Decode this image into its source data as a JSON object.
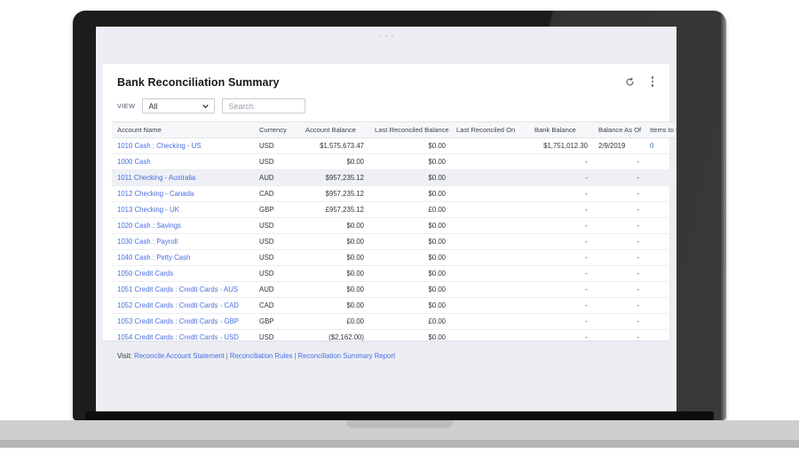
{
  "app": {
    "title": "Bank Reconciliation Summary"
  },
  "header": {
    "refresh_icon": "refresh-icon",
    "menu_icon": "kebab-menu-icon"
  },
  "toolbar": {
    "view_label": "VIEW",
    "view_value": "All",
    "view_options": [
      "All"
    ],
    "search_placeholder": "Search",
    "search_value": ""
  },
  "table": {
    "columns": [
      "Account Name",
      "Currency",
      "Account Balance",
      "Last Reconciled Balance",
      "Last Reconciled On",
      "Bank Balance",
      "Balance As Of",
      "Items to Match"
    ],
    "rows": [
      {
        "account": "1010 Cash : Checking - US",
        "currency": "USD",
        "account_balance": "$1,575,673.47",
        "last_reconciled_balance": "$0.00",
        "last_reconciled_on": "",
        "bank_balance": "$1,751,012.30",
        "balance_as_of": "2/9/2019",
        "items_to_match": "0",
        "highlight": false
      },
      {
        "account": "1000 Cash",
        "currency": "USD",
        "account_balance": "$0.00",
        "last_reconciled_balance": "$0.00",
        "last_reconciled_on": "",
        "bank_balance": "-",
        "balance_as_of": "-",
        "items_to_match": "-",
        "highlight": false
      },
      {
        "account": "1011 Checking - Australia",
        "currency": "AUD",
        "account_balance": "$957,235.12",
        "last_reconciled_balance": "$0.00",
        "last_reconciled_on": "",
        "bank_balance": "-",
        "balance_as_of": "-",
        "items_to_match": "-",
        "highlight": true
      },
      {
        "account": "1012 Checking - Canada",
        "currency": "CAD",
        "account_balance": "$957,235.12",
        "last_reconciled_balance": "$0.00",
        "last_reconciled_on": "",
        "bank_balance": "-",
        "balance_as_of": "-",
        "items_to_match": "-",
        "highlight": false
      },
      {
        "account": "1013 Checking - UK",
        "currency": "GBP",
        "account_balance": "£957,235.12",
        "last_reconciled_balance": "£0.00",
        "last_reconciled_on": "",
        "bank_balance": "-",
        "balance_as_of": "-",
        "items_to_match": "-",
        "highlight": false
      },
      {
        "account": "1020 Cash : Savings",
        "currency": "USD",
        "account_balance": "$0.00",
        "last_reconciled_balance": "$0.00",
        "last_reconciled_on": "",
        "bank_balance": "-",
        "balance_as_of": "-",
        "items_to_match": "-",
        "highlight": false
      },
      {
        "account": "1030 Cash : Payroll",
        "currency": "USD",
        "account_balance": "$0.00",
        "last_reconciled_balance": "$0.00",
        "last_reconciled_on": "",
        "bank_balance": "-",
        "balance_as_of": "-",
        "items_to_match": "-",
        "highlight": false
      },
      {
        "account": "1040 Cash : Petty Cash",
        "currency": "USD",
        "account_balance": "$0.00",
        "last_reconciled_balance": "$0.00",
        "last_reconciled_on": "",
        "bank_balance": "-",
        "balance_as_of": "-",
        "items_to_match": "-",
        "highlight": false
      },
      {
        "account": "1050 Credit Cards",
        "currency": "USD",
        "account_balance": "$0.00",
        "last_reconciled_balance": "$0.00",
        "last_reconciled_on": "",
        "bank_balance": "-",
        "balance_as_of": "-",
        "items_to_match": "-",
        "highlight": false
      },
      {
        "account": "1051 Credit Cards : Credit Cards - AUS",
        "currency": "AUD",
        "account_balance": "$0.00",
        "last_reconciled_balance": "$0.00",
        "last_reconciled_on": "",
        "bank_balance": "-",
        "balance_as_of": "-",
        "items_to_match": "-",
        "highlight": false
      },
      {
        "account": "1052 Credit Cards : Credit Cards - CAD",
        "currency": "CAD",
        "account_balance": "$0.00",
        "last_reconciled_balance": "$0.00",
        "last_reconciled_on": "",
        "bank_balance": "-",
        "balance_as_of": "-",
        "items_to_match": "-",
        "highlight": false
      },
      {
        "account": "1053 Credit Cards : Credit Cards - GBP",
        "currency": "GBP",
        "account_balance": "£0.00",
        "last_reconciled_balance": "£0.00",
        "last_reconciled_on": "",
        "bank_balance": "-",
        "balance_as_of": "-",
        "items_to_match": "-",
        "highlight": false
      },
      {
        "account": "1054 Credit Cards : Credit Cards - USD",
        "currency": "USD",
        "account_balance": "($2,162.00)",
        "last_reconciled_balance": "$0.00",
        "last_reconciled_on": "",
        "bank_balance": "-",
        "balance_as_of": "-",
        "items_to_match": "-",
        "highlight": false
      }
    ]
  },
  "footer": {
    "prefix": "Visit:",
    "links": [
      "Reconcile Account Statement",
      "Reconciliation Rules",
      "Reconciliation Summary Report"
    ],
    "separator": "|"
  },
  "colors": {
    "link": "#4a6ee0",
    "screen_bg": "#eceef4",
    "header_bg": "#f6f7f9",
    "row_highlight": "#eef0f5"
  }
}
